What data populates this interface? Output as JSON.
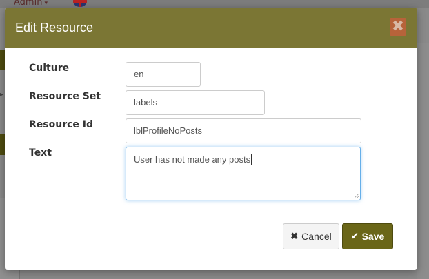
{
  "background": {
    "admin_menu_label": "Admin",
    "admin_caret": "▾",
    "left_glyph": "▸"
  },
  "modal": {
    "title": "Edit Resource",
    "close_icon": "✖",
    "fields": {
      "culture": {
        "label": "Culture",
        "value": "en"
      },
      "resource_set": {
        "label": "Resource Set",
        "value": "labels"
      },
      "resource_id": {
        "label": "Resource Id",
        "value": "lblProfileNoPosts"
      },
      "text": {
        "label": "Text",
        "value": "User has not made any posts"
      }
    },
    "buttons": {
      "cancel_icon": "✖",
      "cancel_label": "Cancel",
      "save_icon": "✔",
      "save_label": "Save"
    }
  },
  "colors": {
    "header": "#7b7634",
    "save_button": "#6a6618",
    "close_button": "#b7633a",
    "focus_border": "#66afe9"
  }
}
